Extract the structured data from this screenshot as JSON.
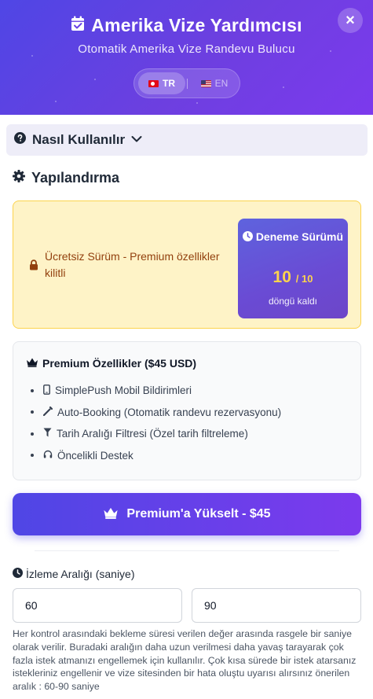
{
  "header": {
    "title": "Amerika Vize Yardımcısı",
    "subtitle": "Otomatik Amerika Vize Randevu Bulucu",
    "close_label": "×",
    "languages": [
      {
        "code": "TR",
        "flag_icon": "turkey-flag-icon",
        "active": true
      },
      {
        "code": "EN",
        "flag_icon": "us-flag-icon",
        "active": false
      }
    ],
    "gradient_colors": [
      "#4f46e5",
      "#7c3aed"
    ]
  },
  "howto": {
    "label": "Nasıl Kullanılır",
    "expanded": false
  },
  "config": {
    "title": "Yapılandırma"
  },
  "free_notice": {
    "text": "Ücretsiz Sürüm - Premium özellikler kilitli",
    "trial": {
      "title": "Deneme Sürümü",
      "remaining": "10",
      "total": "/ 10",
      "sub": "döngü kaldı"
    }
  },
  "premium": {
    "title": "Premium Özellikler ($45 USD)",
    "features": [
      {
        "icon": "mobile-phone-icon",
        "label": "SimplePush Mobil Bildirimleri"
      },
      {
        "icon": "magic-wand-icon",
        "label": "Auto-Booking (Otomatik randevu rezervasyonu)"
      },
      {
        "icon": "filter-icon",
        "label": "Tarih Aralığı Filtresi (Özel tarih filtreleme)"
      },
      {
        "icon": "headset-icon",
        "label": "Öncelikli Destek"
      }
    ]
  },
  "upgrade_button": {
    "label": "Premium'a Yükselt - $45"
  },
  "interval": {
    "label": "İzleme Aralığı (saniye)",
    "min_value": "60",
    "max_value": "90",
    "help": "Her kontrol arasındaki bekleme süresi verilen değer arasında rasgele bir saniye olarak verilir. Buradaki aralığın daha uzun verilmesi daha yavaş tarayarak çok fazla istek atmanızı engellemek için kullanılır. Çok kısa sürede bir istek atarsanız istekleriniz engellenir ve vize sitesinden bir hata oluştu uyarısı alırsınız önerilen aralık : 60-90 saniye"
  }
}
